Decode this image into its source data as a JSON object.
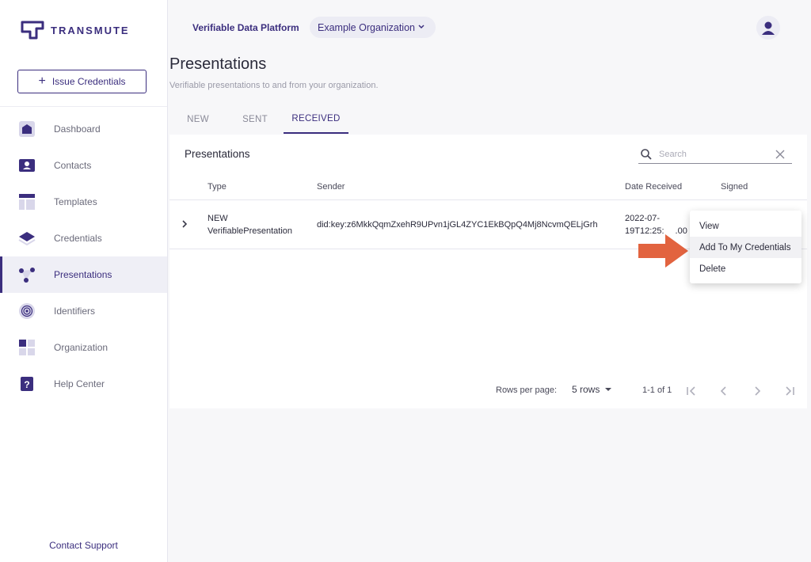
{
  "brand": {
    "name": "TRANSMUTE"
  },
  "sidebar": {
    "issue_button": "Issue Credentials",
    "items": [
      {
        "label": "Dashboard",
        "icon": "home-icon"
      },
      {
        "label": "Contacts",
        "icon": "contact-card-icon"
      },
      {
        "label": "Templates",
        "icon": "template-icon"
      },
      {
        "label": "Credentials",
        "icon": "credential-stack-icon"
      },
      {
        "label": "Presentations",
        "icon": "presentation-nodes-icon"
      },
      {
        "label": "Identifiers",
        "icon": "fingerprint-icon"
      },
      {
        "label": "Organization",
        "icon": "organization-grid-icon"
      },
      {
        "label": "Help Center",
        "icon": "help-icon"
      }
    ],
    "active_item": "Presentations",
    "contact_support": "Contact Support"
  },
  "header": {
    "platform": "Verifiable Data Platform",
    "organization": "Example Organization"
  },
  "page": {
    "title": "Presentations",
    "subtitle": "Verifiable presentations to and from your organization."
  },
  "tabs": [
    {
      "label": "NEW"
    },
    {
      "label": "SENT"
    },
    {
      "label": "RECEIVED"
    }
  ],
  "active_tab": "RECEIVED",
  "table": {
    "title": "Presentations",
    "search_placeholder": "Search",
    "columns": [
      "Type",
      "Sender",
      "Date Received",
      "Signed"
    ],
    "rows": [
      {
        "type_line1": "NEW",
        "type_line2": "VerifiablePresentation",
        "sender": "did:key:z6MkkQqmZxehR9UPvn1jGL4ZYC1EkBQpQ4Mj8NcvmQELjGrh",
        "date_line1": "2022-07-",
        "date_line2": "19T12:25:",
        "date_line2_tail": ".00"
      }
    ],
    "pagination": {
      "rows_per_page_label": "Rows per page:",
      "rows_per_page_value": "5 rows",
      "range": "1-1 of 1"
    }
  },
  "context_menu": {
    "items": [
      "View",
      "Add To My Credentials",
      "Delete"
    ],
    "highlighted": "Add To My Credentials"
  },
  "colors": {
    "brand": "#3b2e7e",
    "arrow": "#e2633f",
    "active_bg": "#efeff6"
  }
}
